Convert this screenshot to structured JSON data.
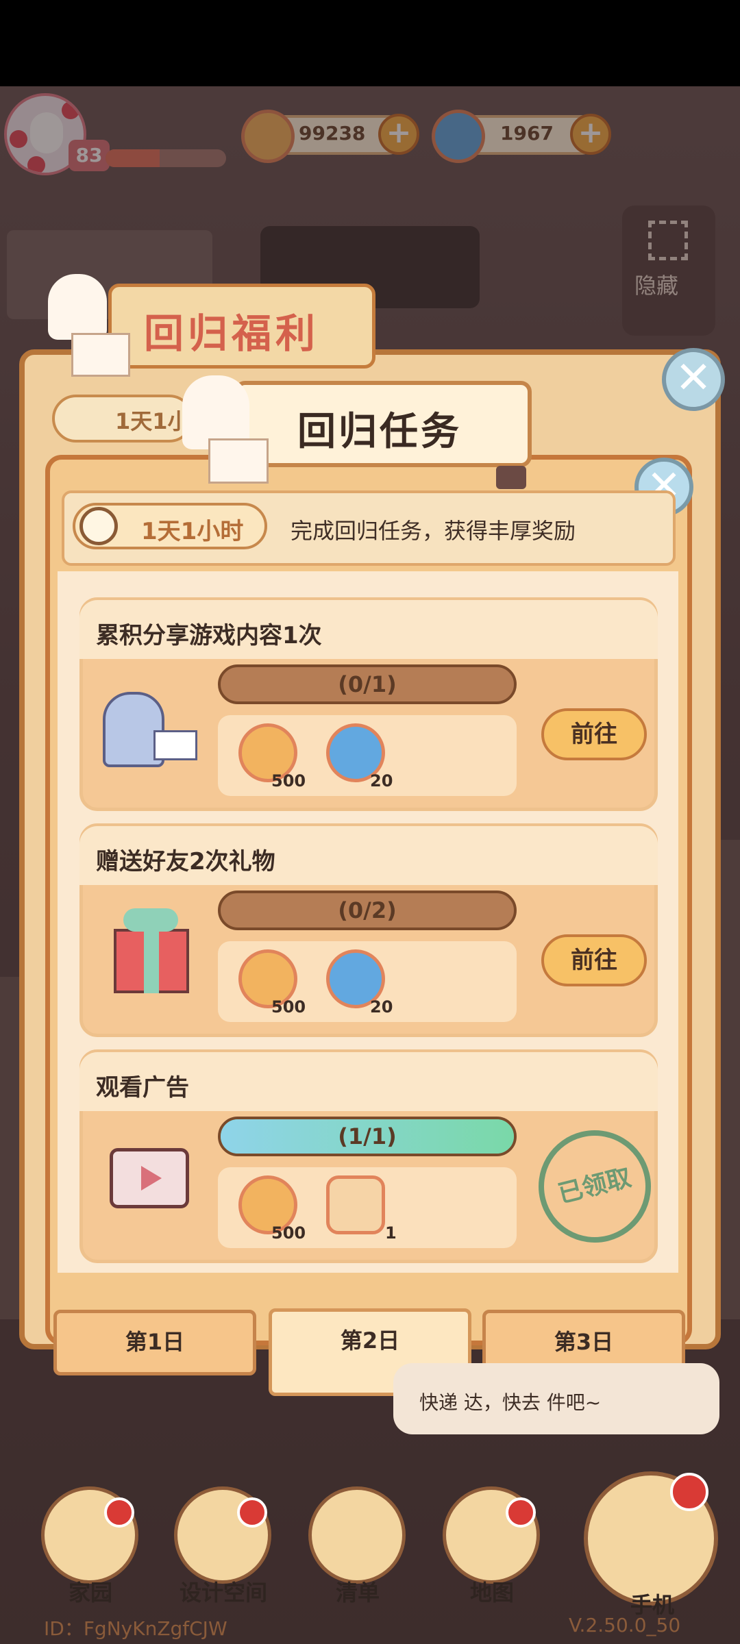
{
  "hud": {
    "level": "83",
    "xp_progress": 0.45,
    "coins": "99238",
    "gems": "1967",
    "plus": "+"
  },
  "side": {
    "hide_label": "隐藏"
  },
  "back_panel": {
    "title": "回归福利",
    "timer": "1天1小",
    "close": "✕"
  },
  "dialog": {
    "title": "回归任务",
    "close": "✕",
    "timer": "1天1小时",
    "description": "完成回归任务，获得丰厚奖励"
  },
  "tasks": [
    {
      "title": "累积分享游戏内容1次",
      "progress_text": "(0/1)",
      "progress": 0,
      "rewards": [
        {
          "icon": "coin-icon",
          "amount": "500"
        },
        {
          "icon": "swirl-gem-icon",
          "amount": "20"
        }
      ],
      "action": "前往"
    },
    {
      "title": "赠送好友2次礼物",
      "progress_text": "(0/2)",
      "progress": 0,
      "rewards": [
        {
          "icon": "coin-icon",
          "amount": "500"
        },
        {
          "icon": "swirl-gem-icon",
          "amount": "20"
        }
      ],
      "action": "前往"
    },
    {
      "title": "观看广告",
      "progress_text": "(1/1)",
      "progress": 1,
      "rewards": [
        {
          "icon": "coin-icon",
          "amount": "500"
        },
        {
          "icon": "paw-ticket-icon",
          "amount": "1"
        }
      ],
      "status": "已领取"
    }
  ],
  "day_tabs": [
    {
      "label": "第1日"
    },
    {
      "label": "第2日"
    },
    {
      "label": "第3日"
    }
  ],
  "bubble": {
    "text": "快递  达，快去  件吧~"
  },
  "nav": [
    {
      "label": "家园"
    },
    {
      "label": "设计空间"
    },
    {
      "label": "清单"
    },
    {
      "label": "地图"
    },
    {
      "label": "手机"
    }
  ],
  "footer": {
    "uid": "ID：FgNyKnZgfCJW",
    "version": "V.2.50.0_50"
  }
}
